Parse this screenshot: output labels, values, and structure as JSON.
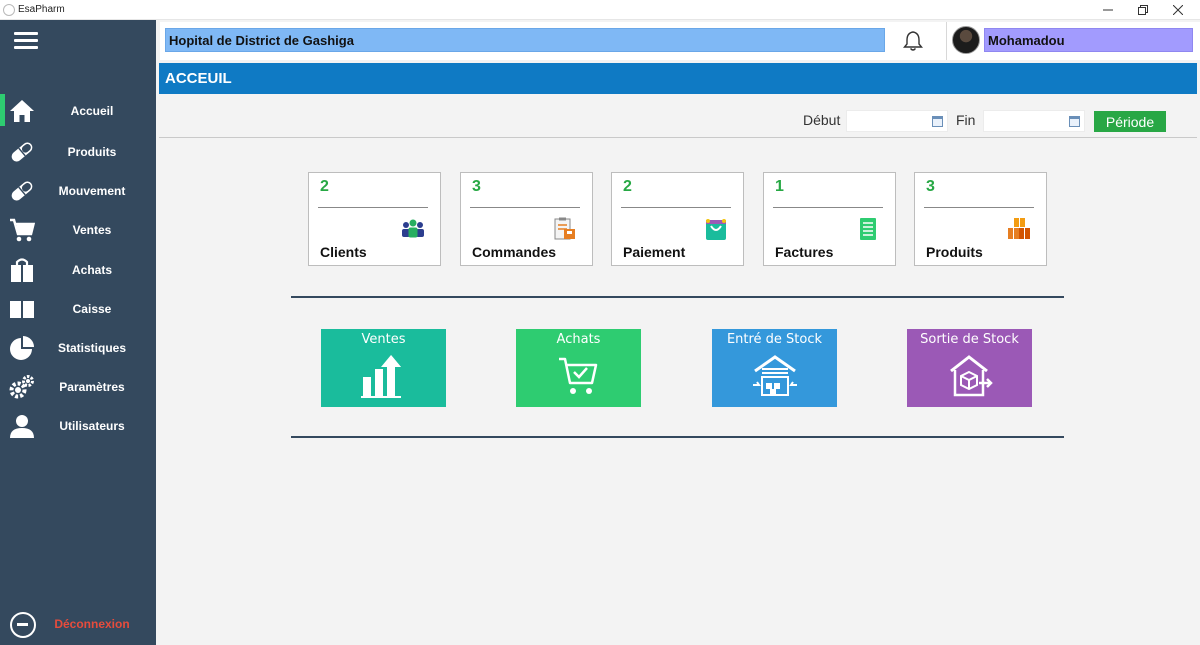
{
  "window": {
    "title": "EsaPharm"
  },
  "colors": {
    "sidebar_bg": "#34495e",
    "active_accent": "#2ecc71",
    "header_bg": "#0f7ac4",
    "hospital_bg": "#7fb8f5",
    "user_bg": "#a29bfe",
    "stat_number": "#27a844",
    "periode_button": "#28a745",
    "logout_text": "#e74c3c"
  },
  "sidebar": {
    "items": [
      {
        "label": "Accueil",
        "icon": "home-icon",
        "active": true
      },
      {
        "label": "Produits",
        "icon": "pill-icon"
      },
      {
        "label": "Mouvement",
        "icon": "pill-icon"
      },
      {
        "label": "Ventes",
        "icon": "cart-icon"
      },
      {
        "label": "Achats",
        "icon": "shopping-bag-icon"
      },
      {
        "label": "Caisse",
        "icon": "book-icon"
      },
      {
        "label": "Statistiques",
        "icon": "pie-chart-icon"
      },
      {
        "label": "Paramètres",
        "icon": "gears-icon"
      },
      {
        "label": "Utilisateurs",
        "icon": "user-icon"
      }
    ],
    "logout": {
      "label": "Déconnexion",
      "icon": "minus-circle-icon"
    }
  },
  "topbar": {
    "hospital": "Hopital de District de Gashiga",
    "notification_icon": "bell-icon",
    "username": "Mohamadou"
  },
  "page": {
    "title": "ACCEUIL"
  },
  "filter": {
    "start_label": "Début",
    "start_value": "",
    "end_label": "Fin",
    "end_value": "",
    "button": "Période"
  },
  "stats": [
    {
      "value": "2",
      "label": "Clients",
      "icon": "people-icon"
    },
    {
      "value": "3",
      "label": "Commandes",
      "icon": "clipboard-icon"
    },
    {
      "value": "2",
      "label": "Paiement",
      "icon": "shopping-bag-icon"
    },
    {
      "value": "1",
      "label": "Factures",
      "icon": "invoice-icon"
    },
    {
      "value": "3",
      "label": "Produits",
      "icon": "boxes-icon"
    }
  ],
  "actions": [
    {
      "label": "Ventes",
      "icon": "growth-chart-icon",
      "color": "#1abc9c"
    },
    {
      "label": "Achats",
      "icon": "cart-check-icon",
      "color": "#2ecc71"
    },
    {
      "label": "Entré de Stock",
      "icon": "warehouse-in-icon",
      "color": "#3498db"
    },
    {
      "label": "Sortie de Stock",
      "icon": "warehouse-out-icon",
      "color": "#9b59b6"
    }
  ]
}
